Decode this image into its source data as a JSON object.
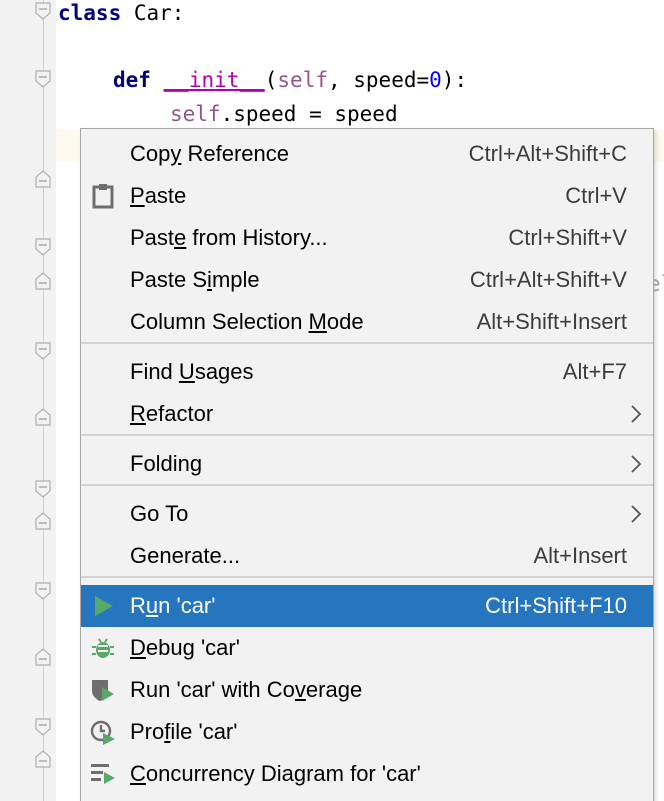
{
  "editor": {
    "line1": {
      "keyword": "class",
      "rest": " Car:"
    },
    "line2": {
      "keyword": "def",
      "name": "__init__",
      "open": "(",
      "self": "self",
      "params": ", speed=",
      "default": "0",
      "close": "):"
    },
    "line3": {
      "self": "self",
      "rest": ".speed = speed"
    },
    "fragment": "el"
  },
  "menu": {
    "items": [
      {
        "label_pre": "Cop",
        "mnemonic": "y",
        "label_post": " Reference",
        "shortcut": "Ctrl+Alt+Shift+C",
        "icon": ""
      },
      {
        "label_pre": "",
        "mnemonic": "P",
        "label_post": "aste",
        "shortcut": "Ctrl+V",
        "icon": "clipboard-icon"
      },
      {
        "label_pre": "Past",
        "mnemonic": "e",
        "label_post": " from History...",
        "shortcut": "Ctrl+Shift+V",
        "icon": ""
      },
      {
        "label_pre": "Paste S",
        "mnemonic": "i",
        "label_post": "mple",
        "shortcut": "Ctrl+Alt+Shift+V",
        "icon": ""
      },
      {
        "label_pre": "Column Selection ",
        "mnemonic": "M",
        "label_post": "ode",
        "shortcut": "Alt+Shift+Insert",
        "icon": ""
      },
      {
        "label_pre": "Find ",
        "mnemonic": "U",
        "label_post": "sages",
        "shortcut": "Alt+F7",
        "icon": ""
      },
      {
        "label_pre": "",
        "mnemonic": "R",
        "label_post": "efactor",
        "shortcut": "",
        "icon": "",
        "submenu": true
      },
      {
        "label_pre": "Folding",
        "mnemonic": "",
        "label_post": "",
        "shortcut": "",
        "icon": "",
        "submenu": true
      },
      {
        "label_pre": "Go To",
        "mnemonic": "",
        "label_post": "",
        "shortcut": "",
        "icon": "",
        "submenu": true
      },
      {
        "label_pre": "Generate...",
        "mnemonic": "",
        "label_post": "",
        "shortcut": "Alt+Insert",
        "icon": ""
      },
      {
        "label_pre": "R",
        "mnemonic": "u",
        "label_post": "n 'car'",
        "shortcut": "Ctrl+Shift+F10",
        "icon": "run-icon",
        "selected": true
      },
      {
        "label_pre": "",
        "mnemonic": "D",
        "label_post": "ebug 'car'",
        "shortcut": "",
        "icon": "debug-icon"
      },
      {
        "label_pre": "Run 'car' with Co",
        "mnemonic": "v",
        "label_post": "erage",
        "shortcut": "",
        "icon": "coverage-icon"
      },
      {
        "label_pre": "Pro",
        "mnemonic": "f",
        "label_post": "ile 'car'",
        "shortcut": "",
        "icon": "profile-icon"
      },
      {
        "label_pre": "",
        "mnemonic": "C",
        "label_post": "oncurrency Diagram for 'car'",
        "shortcut": "",
        "icon": "concurrency-icon"
      }
    ]
  },
  "colors": {
    "selection": "#2675bf",
    "menu_bg": "#f2f2f2",
    "run_green": "#59a869",
    "keyword": "#000080",
    "magic": "#b200b2",
    "self": "#94558d",
    "number": "#0000ff"
  }
}
